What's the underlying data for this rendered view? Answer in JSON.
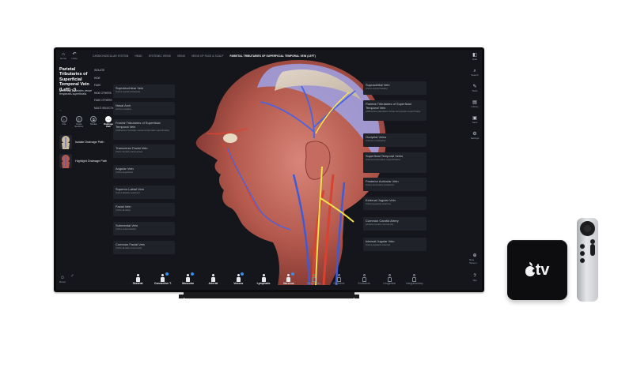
{
  "top_nav": {
    "home_label": "Home",
    "undo_label": "Undo",
    "breadcrumbs": [
      "CARDIOVASCULAR SYSTEM",
      "HEAD",
      "SYSTEMIC VEINS",
      "VEINS",
      "VEINS OF FACE & SCALP",
      "PARIETAL TRIBUTARIES OF SUPERFICIAL TEMPORAL VEIN (LEFT)"
    ]
  },
  "info_panel": {
    "title": "Parietal Tributaries of Superficial Temporal Vein (Left)",
    "audio_icon": "speaker-icon",
    "latin": "Affluentes parietales venae temporalis superficialis",
    "more": "...",
    "actions": [
      "ISOLATE",
      "HIDE",
      "FADE",
      "HIDE OTHERS",
      "FADE OTHERS",
      "MULTI SELECTION"
    ],
    "modes": [
      {
        "icon": "info-icon",
        "label": "Info"
      },
      {
        "icon": "cross-sections-icon",
        "label": "Cross Sections"
      },
      {
        "icon": "similar-icon",
        "label": "Similar"
      },
      {
        "icon": "drainage-path-icon",
        "label": "Drainage Path",
        "active": true
      }
    ],
    "paths": [
      {
        "label": "Isolate Drainage Path"
      },
      {
        "label": "Highlight Drainage Path"
      }
    ]
  },
  "labels_left": [
    {
      "name": "Supratrochlear Vein",
      "latin": "(Vena supratrochlearis)"
    },
    {
      "name": "Nasal Arch",
      "latin": "(Arcus nasalis)"
    },
    {
      "name": "Frontal Tributaries of Superficial Temporal Vein",
      "latin": "(Affluentes frontales venae temporalis superficialis)"
    },
    {
      "name": "Transverse Facial Vein",
      "latin": "(Vena facialis transversa)"
    },
    {
      "name": "Angular Vein",
      "latin": "(Vena angularis)"
    },
    {
      "name": "Superior Labial Vein",
      "latin": "(Vena labialis superior)"
    },
    {
      "name": "Facial Vein",
      "latin": "(Vena facialis)"
    },
    {
      "name": "Submental Vein",
      "latin": "(Vena submentalis)"
    },
    {
      "name": "Common Facial Vein",
      "latin": "(Vena facialis communis)"
    }
  ],
  "labels_right": [
    {
      "name": "Supraorbital Vein",
      "latin": "(Vena supraorbitalis)"
    },
    {
      "name": "Parietal Tributaries of Superficial Temporal Vein",
      "latin": "(Affluentes parietales venae temporalis superficialis)"
    },
    {
      "name": "Occipital Veins",
      "latin": "(Venae occipitales)"
    },
    {
      "name": "Superficial Temporal Veins",
      "latin": "(Venae temporales superficiales)"
    },
    {
      "name": "Posterior Auricular Vein",
      "latin": "(Vena auricularis posterior)"
    },
    {
      "name": "External Jugular Vein",
      "latin": "(Vena jugularis externa)"
    },
    {
      "name": "Common Carotid Artery",
      "latin": "(Arteria carotis communis)"
    },
    {
      "name": "Internal Jugular Vein",
      "latin": "(Vena jugularis interna)"
    }
  ],
  "right_toolbar": [
    {
      "icon": "hide-icon",
      "label": "Hide"
    },
    {
      "icon": "search-icon",
      "label": "Search"
    },
    {
      "icon": "tools-icon",
      "label": "Tools"
    },
    {
      "icon": "library-icon",
      "label": "Library"
    },
    {
      "icon": "save-icon",
      "label": "Save"
    },
    {
      "icon": "settings-icon",
      "label": "Settings"
    }
  ],
  "right_bottom": [
    {
      "icon": "plus-icon",
      "label": "New Screen"
    },
    {
      "icon": "help-icon",
      "label": "Tips"
    }
  ],
  "bottom_left": {
    "reset_label": "Reset",
    "gender_icon": "male-icon"
  },
  "systems": [
    {
      "layer": "Layer 1",
      "label": "Skeletal",
      "on": true,
      "badge": false
    },
    {
      "layer": "Layer 1",
      "label": "Connective T.",
      "on": true,
      "badge": true
    },
    {
      "layer": "Layer 1",
      "label": "Muscular",
      "on": true,
      "badge": true
    },
    {
      "layer": "Layer 1",
      "label": "Arterial",
      "on": true,
      "badge": false
    },
    {
      "layer": "Layer 1",
      "label": "Venous",
      "on": true,
      "badge": true
    },
    {
      "layer": "Layer 1",
      "label": "Lymphatic",
      "on": true,
      "badge": false
    },
    {
      "layer": "Layer 1",
      "label": "Nervous",
      "on": true,
      "badge": true
    },
    {
      "layer": "",
      "label": "Respiratory",
      "on": false,
      "badge": false
    },
    {
      "layer": "",
      "label": "Digestive",
      "on": false,
      "badge": false
    },
    {
      "layer": "",
      "label": "Endocrine",
      "on": false,
      "badge": false
    },
    {
      "layer": "",
      "label": "Urogenital",
      "on": false,
      "badge": false
    },
    {
      "layer": "",
      "label": "Integumentary",
      "on": false,
      "badge": false
    }
  ],
  "apple_tv": {
    "logo_text": "tv",
    "logo_icon": "apple-logo-icon"
  }
}
